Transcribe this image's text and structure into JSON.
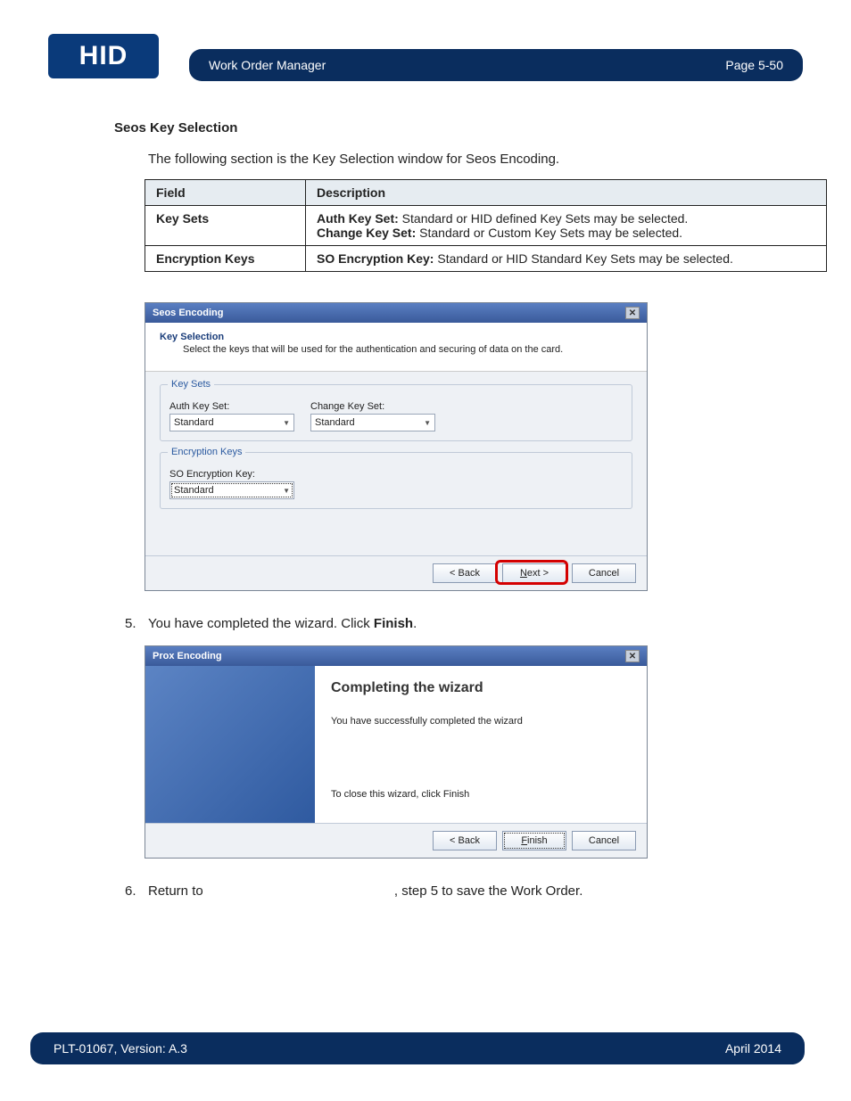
{
  "header": {
    "logo_text": "HID",
    "title": "Work Order Manager",
    "page": "Page 5-50"
  },
  "section": {
    "title": "Seos Key Selection",
    "intro": "The following section is the Key Selection window for Seos Encoding."
  },
  "table": {
    "hdr_field": "Field",
    "hdr_desc": "Description",
    "rows": [
      {
        "field": "Key Sets",
        "d_b1": "Auth Key Set:",
        "d_t1": " Standard or HID defined Key Sets may be selected.",
        "d_b2": "Change Key Set:",
        "d_t2": " Standard or Custom Key Sets may be selected."
      },
      {
        "field": "Encryption Keys",
        "d_b1": "SO Encryption Key:",
        "d_t1": " Standard or HID Standard Key Sets may be selected.",
        "d_b2": "",
        "d_t2": ""
      }
    ]
  },
  "dlg1": {
    "title": "Seos Encoding",
    "head_title": "Key Selection",
    "head_sub": "Select the keys that will be used for the authentication and securing of data on the card.",
    "keysets_legend": "Key Sets",
    "auth_label": "Auth Key Set:",
    "auth_value": "Standard",
    "change_label": "Change Key Set:",
    "change_value": "Standard",
    "enc_legend": "Encryption Keys",
    "so_label": "SO Encryption Key:",
    "so_value": "Standard",
    "back": "< Back",
    "next_u": "N",
    "next_r": "ext >",
    "cancel": "Cancel"
  },
  "step5": {
    "num": "5.",
    "pre": "You have completed the wizard. Click ",
    "bold": "Finish",
    "post": "."
  },
  "dlg2": {
    "title": "Prox Encoding",
    "heading": "Completing the wizard",
    "txt1": "You have successfully completed the wizard",
    "txt2": "To close this wizard, click Finish",
    "back": "< Back",
    "finish_u": "F",
    "finish_r": "inish",
    "cancel": "Cancel"
  },
  "step6": {
    "num": "6.",
    "pre": "Return to ",
    "post": ", step 5 to save the Work Order."
  },
  "footer": {
    "left": "PLT-01067, Version: A.3",
    "right": "April 2014"
  }
}
